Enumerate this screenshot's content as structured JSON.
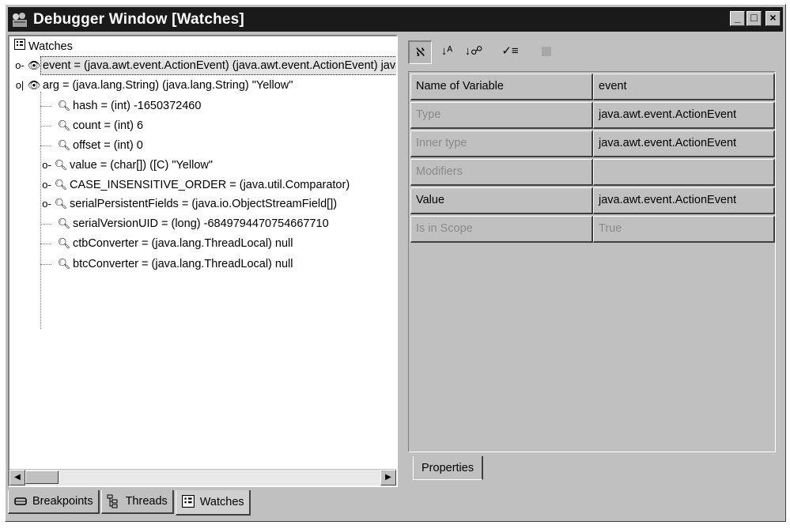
{
  "window": {
    "title": "Debugger Window [Watches]",
    "controls": {
      "minimize": "_",
      "maximize": "□",
      "close": "×"
    }
  },
  "tree": {
    "root_label": "Watches",
    "nodes": [
      {
        "label": "event = (java.awt.event.ActionEvent) (java.awt.event.ActionEvent) java.awt.event.ActionEvent[ACTION_PERFORMED"
      },
      {
        "label": "arg = (java.lang.String) (java.lang.String) \"Yellow\""
      },
      {
        "label": "hash = (int) -1650372460"
      },
      {
        "label": "count = (int) 6"
      },
      {
        "label": "offset = (int) 0"
      },
      {
        "label": "value = (char[]) ([C) \"Yellow\""
      },
      {
        "label": "CASE_INSENSITIVE_ORDER = (java.util.Comparator)"
      },
      {
        "label": "serialPersistentFields = (java.io.ObjectStreamField[])"
      },
      {
        "label": "serialVersionUID = (long) -6849794470754667710"
      },
      {
        "label": "ctbConverter = (java.lang.ThreadLocal) null"
      },
      {
        "label": "btcConverter = (java.lang.ThreadLocal) null"
      }
    ]
  },
  "toolbar": {
    "icons": [
      "sort-default-icon",
      "sort-az-icon",
      "sort-type-icon",
      "customize-icon",
      "disabled-icon"
    ]
  },
  "properties": {
    "rows": [
      {
        "name": "Name of Variable",
        "value": "event",
        "enabled": true
      },
      {
        "name": "Type",
        "value": "java.awt.event.ActionEvent",
        "enabled": false
      },
      {
        "name": "Inner type",
        "value": "java.awt.event.ActionEvent",
        "enabled": false
      },
      {
        "name": "Modifiers",
        "value": "",
        "enabled": false
      },
      {
        "name": "Value",
        "value": "java.awt.event.ActionEvent",
        "enabled": true
      },
      {
        "name": "Is in Scope",
        "value": "True",
        "enabled": false
      }
    ],
    "tab_label": "Properties"
  },
  "bottom_tabs": [
    {
      "label": "Breakpoints",
      "icon": "breakpoints-icon",
      "active": false
    },
    {
      "label": "Threads",
      "icon": "threads-icon",
      "active": false
    },
    {
      "label": "Watches",
      "icon": "watches-icon",
      "active": true
    }
  ]
}
